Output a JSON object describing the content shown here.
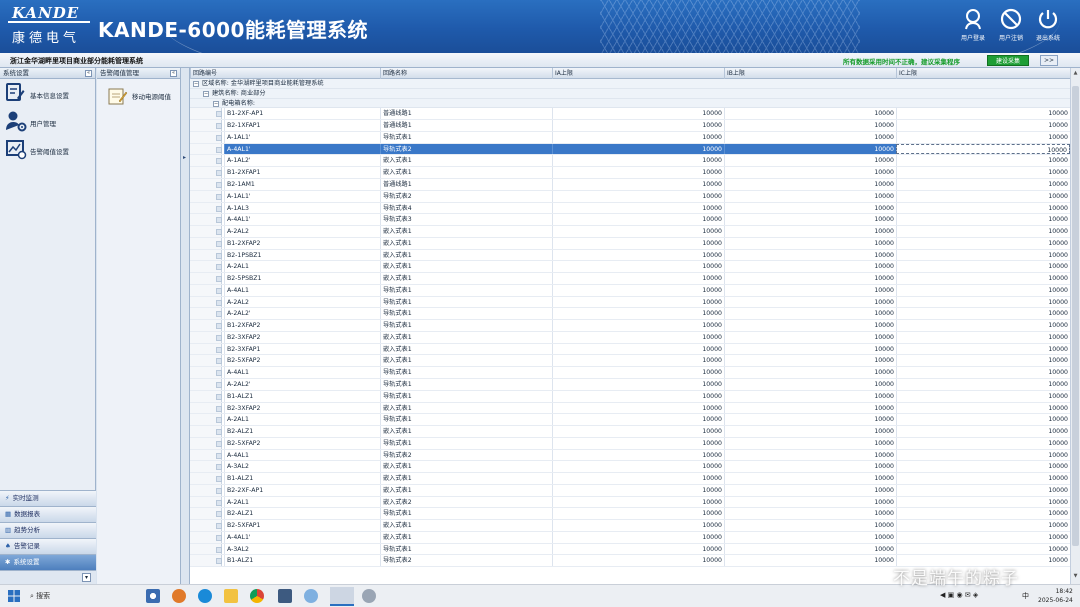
{
  "header": {
    "brand": "KANDE",
    "brand_cn": "康德电气",
    "app_title": "KANDE-6000能耗管理系统",
    "buttons": [
      {
        "label": "用户登录",
        "icon": "user-login-icon"
      },
      {
        "label": "用户注销",
        "icon": "user-logout-icon"
      },
      {
        "label": "退出系统",
        "icon": "power-icon"
      }
    ]
  },
  "subbar": {
    "location": "浙江金华湖畔里项目商业部分能耗管理系统",
    "notice": "所有数据采用时间不正确，建议采集程序",
    "green_button": "建设采集",
    "arrow_button": ">>"
  },
  "left_panel": {
    "title": "系统设置",
    "items": [
      {
        "label": "基本信息设置",
        "icon": "edit-icon"
      },
      {
        "label": "用户管理",
        "icon": "user-gear-icon"
      },
      {
        "label": "告警阈值设置",
        "icon": "alarm-chart-icon"
      }
    ],
    "bottom_items": [
      {
        "label": "实时监测",
        "icon": "lightning-icon"
      },
      {
        "label": "数据报表",
        "icon": "report-icon"
      },
      {
        "label": "趋势分析",
        "icon": "trend-icon"
      },
      {
        "label": "告警记录",
        "icon": "bell-icon"
      },
      {
        "label": "系统设置",
        "icon": "settings-icon"
      }
    ]
  },
  "mid_panel": {
    "title": "告警阈值管理",
    "item": {
      "label": "移动电源阈值",
      "icon": "notepad-icon"
    }
  },
  "grid": {
    "headers": [
      "回路编号",
      "回路名称",
      "IA上限",
      "IB上限",
      "IC上限"
    ],
    "group1": "区域名称: 金华湖畔里项目商业能耗管理系统",
    "group2": "建筑名称: 商业部分",
    "group3": "配电箱名称:",
    "selected_index": 3,
    "rows": [
      [
        "B1-2XF-AP1",
        "普通线路1",
        "10000",
        "10000",
        "10000"
      ],
      [
        "B2-1XFAP1",
        "普通线路1",
        "10000",
        "10000",
        "10000"
      ],
      [
        "A-1AL1'",
        "导轨式表1",
        "10000",
        "10000",
        "10000"
      ],
      [
        "A-4AL1'",
        "导轨式表2",
        "10000",
        "10000",
        "10000"
      ],
      [
        "A-1AL2'",
        "嵌入式表1",
        "10000",
        "10000",
        "10000"
      ],
      [
        "B1-2XFAP1",
        "嵌入式表1",
        "10000",
        "10000",
        "10000"
      ],
      [
        "B2-1AM1",
        "普通线路1",
        "10000",
        "10000",
        "10000"
      ],
      [
        "A-1AL1'",
        "导轨式表2",
        "10000",
        "10000",
        "10000"
      ],
      [
        "A-1AL3",
        "导轨式表4",
        "10000",
        "10000",
        "10000"
      ],
      [
        "A-4AL1'",
        "导轨式表3",
        "10000",
        "10000",
        "10000"
      ],
      [
        "A-2AL2",
        "嵌入式表1",
        "10000",
        "10000",
        "10000"
      ],
      [
        "B1-2XFAP2",
        "嵌入式表1",
        "10000",
        "10000",
        "10000"
      ],
      [
        "B2-1PSBZ1",
        "嵌入式表1",
        "10000",
        "10000",
        "10000"
      ],
      [
        "A-2AL1",
        "嵌入式表1",
        "10000",
        "10000",
        "10000"
      ],
      [
        "B2-5PSBZ1",
        "嵌入式表1",
        "10000",
        "10000",
        "10000"
      ],
      [
        "A-4AL1",
        "导轨式表1",
        "10000",
        "10000",
        "10000"
      ],
      [
        "A-2AL2",
        "导轨式表1",
        "10000",
        "10000",
        "10000"
      ],
      [
        "A-2AL2'",
        "导轨式表1",
        "10000",
        "10000",
        "10000"
      ],
      [
        "B1-2XFAP2",
        "导轨式表1",
        "10000",
        "10000",
        "10000"
      ],
      [
        "B2-3XFAP2",
        "嵌入式表1",
        "10000",
        "10000",
        "10000"
      ],
      [
        "B2-3XFAP1",
        "嵌入式表1",
        "10000",
        "10000",
        "10000"
      ],
      [
        "B2-5XFAP2",
        "嵌入式表1",
        "10000",
        "10000",
        "10000"
      ],
      [
        "A-4AL1",
        "导轨式表1",
        "10000",
        "10000",
        "10000"
      ],
      [
        "A-2AL2'",
        "导轨式表1",
        "10000",
        "10000",
        "10000"
      ],
      [
        "B1-ALZ1",
        "导轨式表1",
        "10000",
        "10000",
        "10000"
      ],
      [
        "B2-3XFAP2",
        "嵌入式表1",
        "10000",
        "10000",
        "10000"
      ],
      [
        "A-2AL1",
        "导轨式表1",
        "10000",
        "10000",
        "10000"
      ],
      [
        "B2-ALZ1",
        "嵌入式表1",
        "10000",
        "10000",
        "10000"
      ],
      [
        "B2-5XFAP2",
        "导轨式表1",
        "10000",
        "10000",
        "10000"
      ],
      [
        "A-4AL1",
        "导轨式表2",
        "10000",
        "10000",
        "10000"
      ],
      [
        "A-3AL2",
        "嵌入式表1",
        "10000",
        "10000",
        "10000"
      ],
      [
        "B1-ALZ1",
        "嵌入式表1",
        "10000",
        "10000",
        "10000"
      ],
      [
        "B2-2XF-AP1",
        "嵌入式表1",
        "10000",
        "10000",
        "10000"
      ],
      [
        "A-2AL1",
        "嵌入式表2",
        "10000",
        "10000",
        "10000"
      ],
      [
        "B2-ALZ1",
        "导轨式表1",
        "10000",
        "10000",
        "10000"
      ],
      [
        "B2-5XFAP1",
        "嵌入式表1",
        "10000",
        "10000",
        "10000"
      ],
      [
        "A-4AL1'",
        "嵌入式表1",
        "10000",
        "10000",
        "10000"
      ],
      [
        "A-3AL2",
        "导轨式表1",
        "10000",
        "10000",
        "10000"
      ],
      [
        "B1-ALZ1",
        "导轨式表2",
        "10000",
        "10000",
        "10000"
      ]
    ]
  },
  "taskbar": {
    "search": "搜索",
    "ime": "中",
    "time": "18:42",
    "date": "2025-06-24"
  },
  "watermark": "不是端午的粽子"
}
